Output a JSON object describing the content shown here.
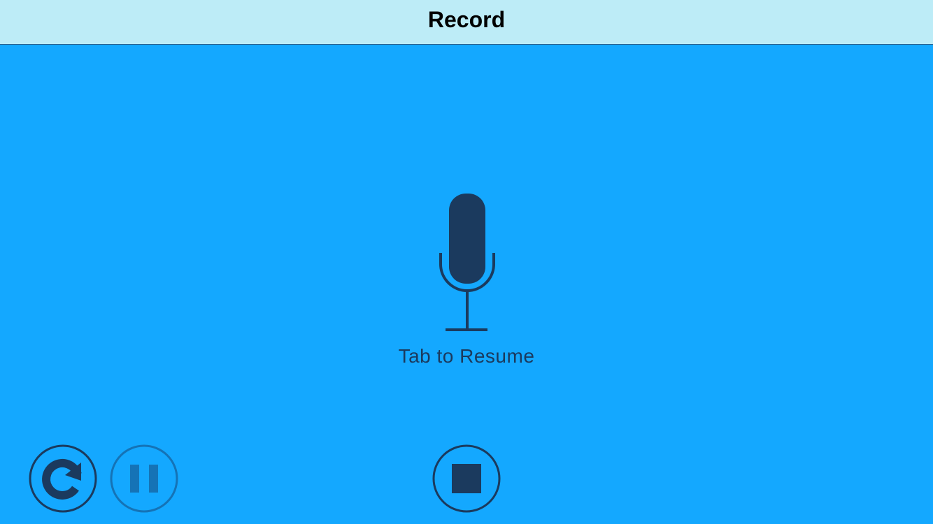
{
  "header": {
    "title": "Record"
  },
  "main": {
    "status_text": "Tab to Resume",
    "mic_icon": "microphone-icon"
  },
  "controls": {
    "restart_icon": "restart-icon",
    "pause_icon": "pause-icon",
    "stop_icon": "stop-icon",
    "pause_disabled": true
  },
  "colors": {
    "background": "#14a8ff",
    "nav_bar": "#bdecf7",
    "icon_dark": "#1b3a5e",
    "icon_disabled": "#1573b6"
  }
}
